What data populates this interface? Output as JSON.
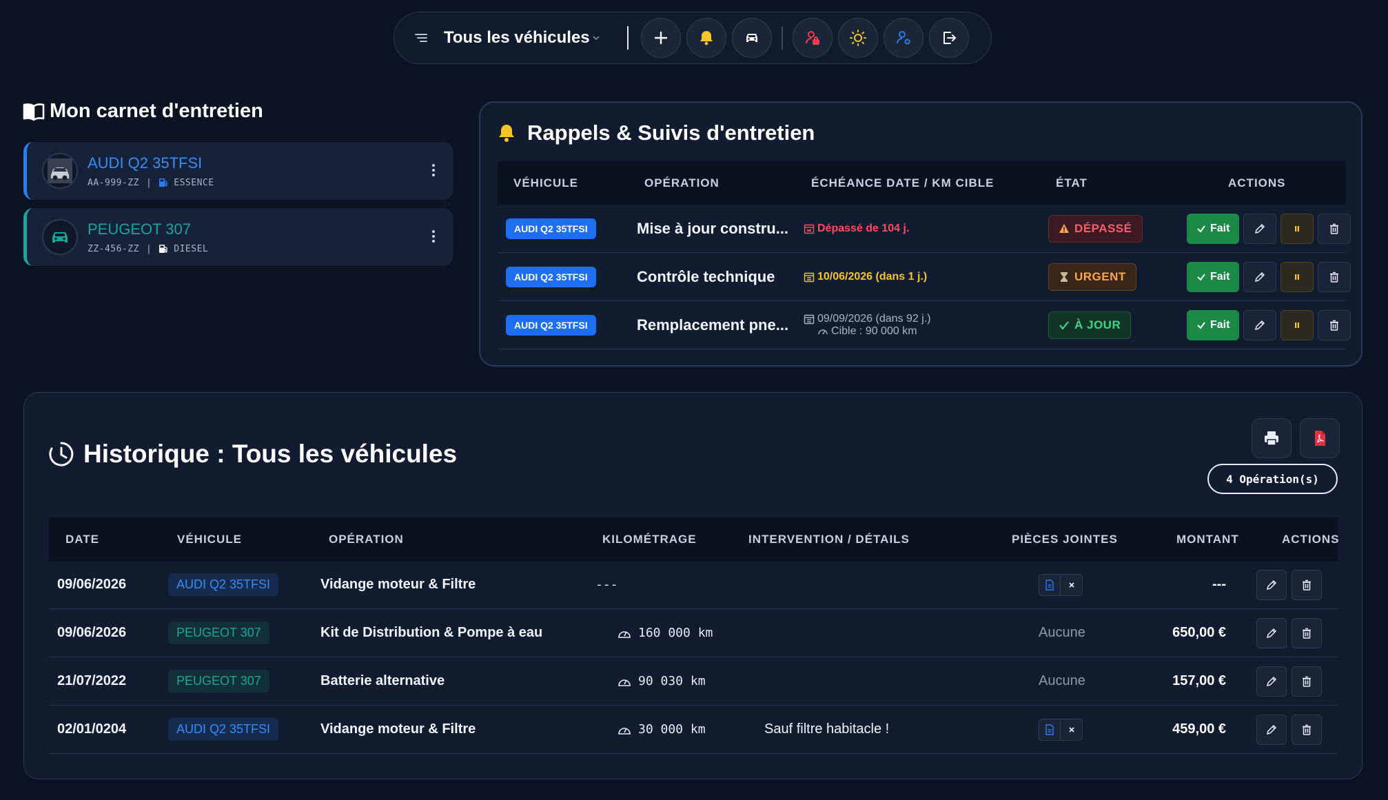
{
  "toolbar": {
    "title": "Tous les véhicules",
    "icons": [
      "menu-icon",
      "plus-icon",
      "bell-icon",
      "car-icon",
      "user-lock-icon",
      "sun-icon",
      "user-gear-icon",
      "logout-icon"
    ]
  },
  "carnet": {
    "title": "Mon carnet d'entretien",
    "vehicles": [
      {
        "name": "AUDI Q2 35TFSI",
        "plate": "AA-999-ZZ",
        "fuel": "ESSENCE",
        "color": "#3c8cf5"
      },
      {
        "name": "PEUGEOT 307",
        "plate": "ZZ-456-ZZ",
        "fuel": "DIESEL",
        "color": "#1aa59a"
      }
    ]
  },
  "rappels": {
    "title": "Rappels & Suivis d'entretien",
    "headers": {
      "vehicle": "VÉHICULE",
      "operation": "OPÉRATION",
      "due": "ÉCHÉANCE DATE / KM CIBLE",
      "state": "ÉTAT",
      "actions": "ACTIONS"
    },
    "done_label": "Fait",
    "rows": [
      {
        "vehicle": "AUDI Q2 35TFSI",
        "operation": "Mise à jour constru...",
        "due_line1": "Dépassé de 104 j.",
        "due_line2": "",
        "state": "DÉPASSÉ",
        "state_kind": "red"
      },
      {
        "vehicle": "AUDI Q2 35TFSI",
        "operation": "Contrôle technique",
        "due_line1": "10/06/2026 (dans 1 j.)",
        "due_line2": "",
        "state": "URGENT",
        "state_kind": "orange"
      },
      {
        "vehicle": "AUDI Q2 35TFSI",
        "operation": "Remplacement pne...",
        "due_line1": "09/09/2026 (dans 92 j.)",
        "due_line2": "Cible : 90 000 km",
        "state": "À JOUR",
        "state_kind": "green"
      }
    ]
  },
  "historique": {
    "title": "Historique : Tous les véhicules",
    "count_badge": "4 Opération(s)",
    "headers": {
      "date": "DATE",
      "vehicle": "VÉHICULE",
      "operation": "OPÉRATION",
      "km": "KILOMÉTRAGE",
      "details": "INTERVENTION / DÉTAILS",
      "attachments": "PIÈCES JOINTES",
      "amount": "MONTANT",
      "actions": "ACTIONS"
    },
    "rows": [
      {
        "date": "09/06/2026",
        "vehicle": "AUDI Q2 35TFSI",
        "vehicle_kind": "blue",
        "operation": "Vidange moteur & Filtre",
        "km": "---",
        "details": "",
        "attachments": "file",
        "amount": "---"
      },
      {
        "date": "09/06/2026",
        "vehicle": "PEUGEOT 307",
        "vehicle_kind": "teal",
        "operation": "Kit de Distribution & Pompe à eau",
        "km": "160 000 km",
        "details": "",
        "attachments": "Aucune",
        "amount": "650,00 €"
      },
      {
        "date": "21/07/2022",
        "vehicle": "PEUGEOT 307",
        "vehicle_kind": "teal",
        "operation": "Batterie alternative",
        "km": "90 030 km",
        "details": "",
        "attachments": "Aucune",
        "amount": "157,00 €"
      },
      {
        "date": "02/01/0204",
        "vehicle": "AUDI Q2 35TFSI",
        "vehicle_kind": "blue",
        "operation": "Vidange moteur & Filtre",
        "km": "30 000 km",
        "details": "Sauf filtre habitacle !",
        "attachments": "file",
        "amount": "459,00 €"
      }
    ]
  }
}
